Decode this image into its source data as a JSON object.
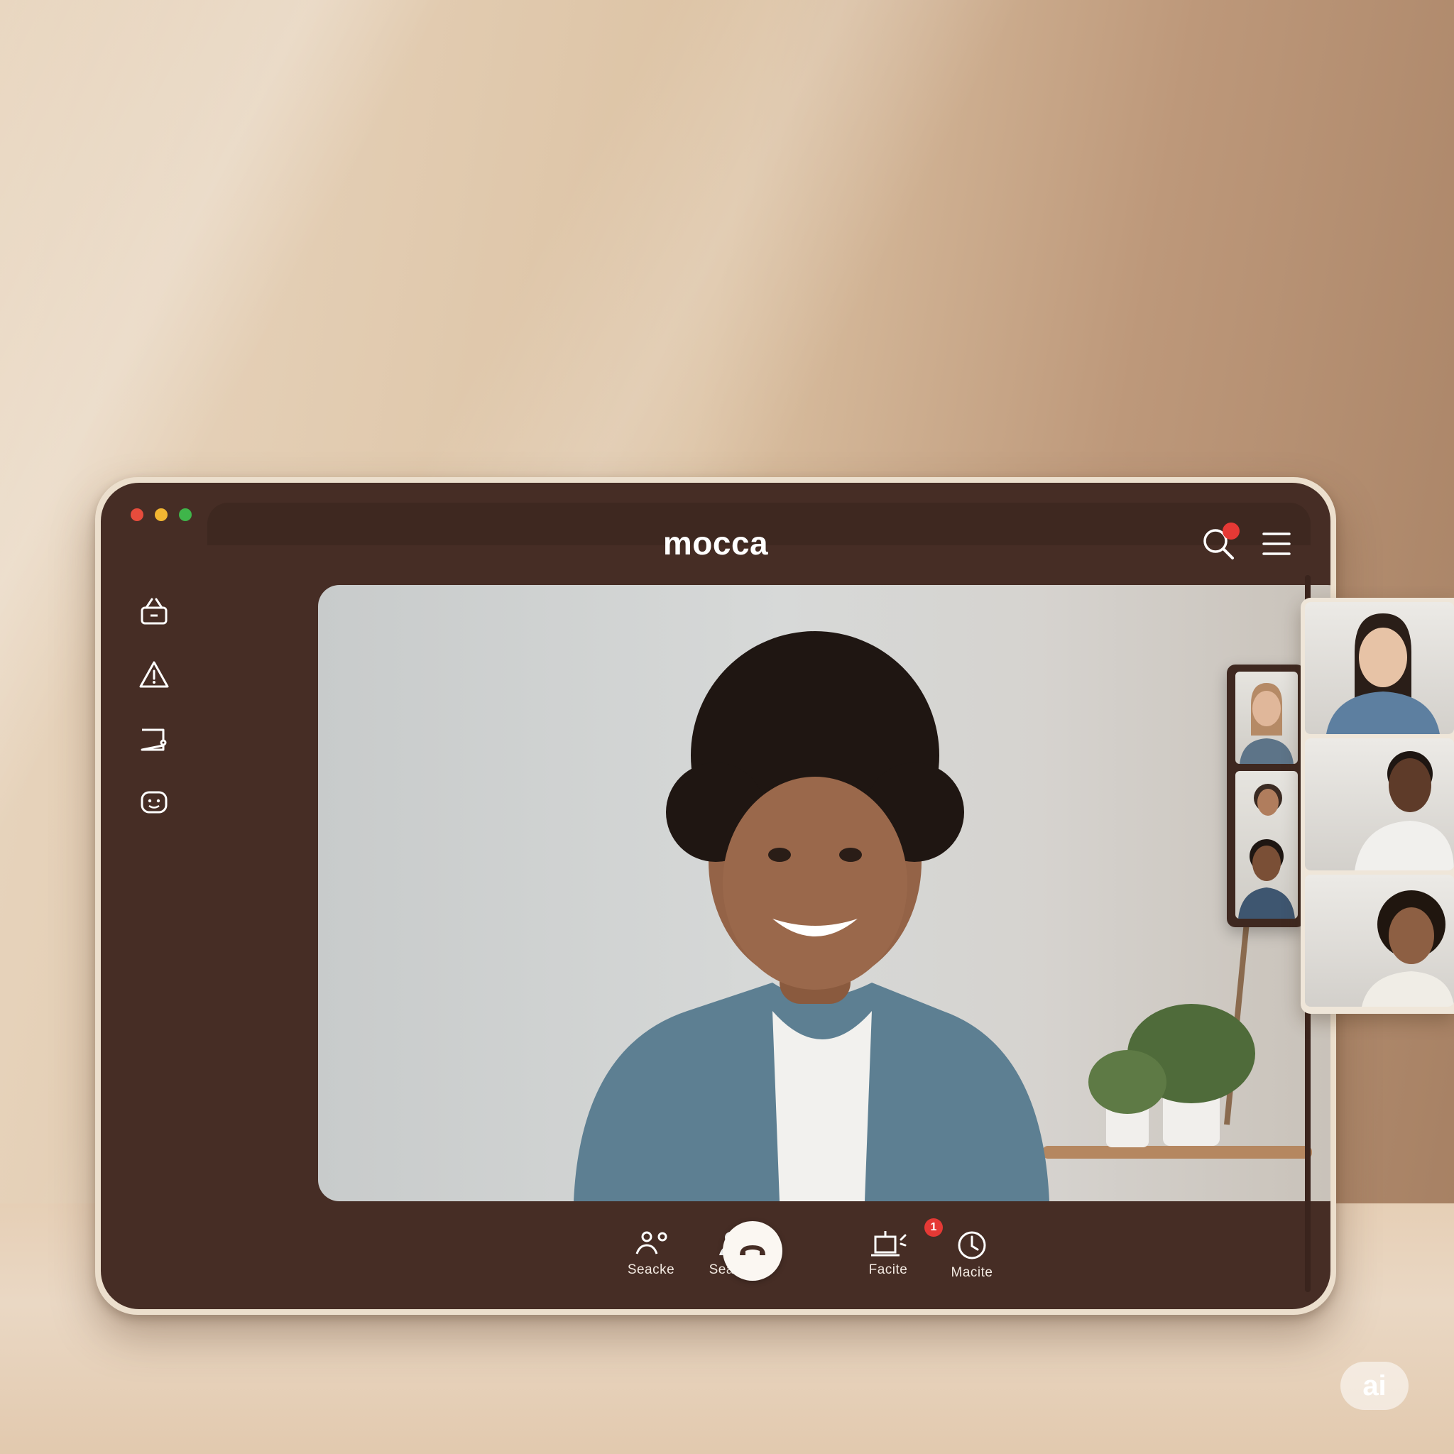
{
  "app": {
    "title": "mocca"
  },
  "window_controls": [
    "close",
    "minimize",
    "maximize"
  ],
  "header": {
    "search_icon": "search-icon",
    "search_badge": "",
    "menu_icon": "hamburger-menu-icon"
  },
  "sidebar": {
    "items": [
      {
        "icon": "basket-icon"
      },
      {
        "icon": "alert-triangle-icon"
      },
      {
        "icon": "chat-tab-icon"
      },
      {
        "icon": "emoji-chat-icon"
      }
    ]
  },
  "main_video": {
    "participant_avatar": "person-avatar"
  },
  "participants_small": [
    {
      "avatar": "person-avatar"
    },
    {
      "avatar": "person-avatar"
    }
  ],
  "participants_large": [
    {
      "avatar": "person-avatar"
    },
    {
      "avatar": "person-avatar"
    },
    {
      "avatar": "person-avatar"
    }
  ],
  "controls": [
    {
      "label": "Seacke",
      "icon": "person-wave-icon"
    },
    {
      "label": "Seaterre",
      "icon": "person-share-icon"
    },
    {
      "label": "Facite",
      "icon": "whiteboard-icon"
    },
    {
      "label": "Macite",
      "icon": "clock-icon",
      "badge": "1"
    }
  ],
  "end_call": {
    "icon": "hang-up-icon"
  },
  "watermark": "ai",
  "colors": {
    "frame": "#462d25",
    "bezel": "#ecdfcd",
    "close": "#e74c3c",
    "minimize": "#f2b632",
    "maximize": "#3fb54a",
    "badge": "#e53935"
  }
}
